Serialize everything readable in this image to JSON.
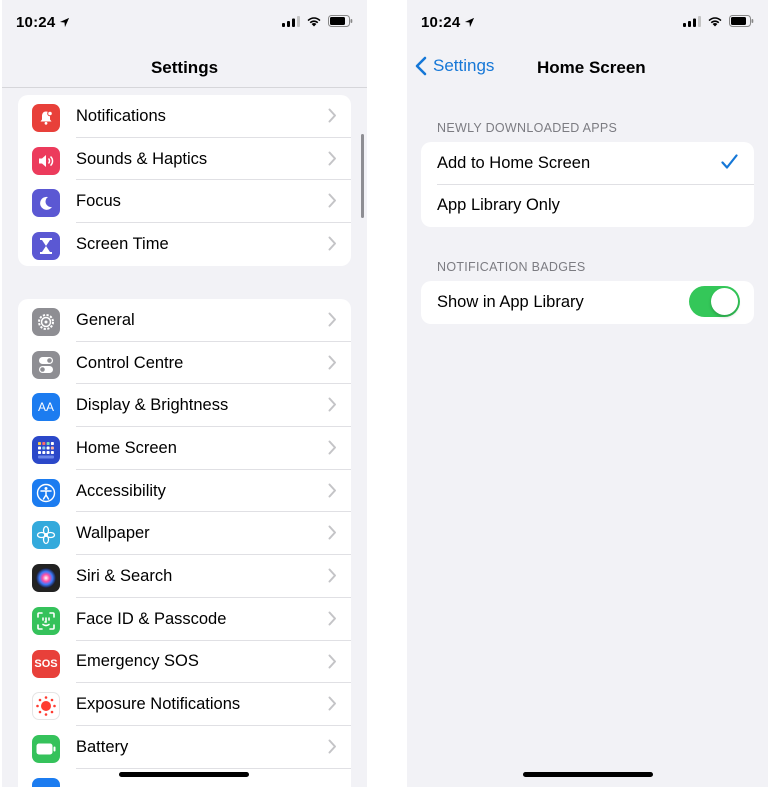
{
  "left": {
    "time": "10:24",
    "nav_title": "Settings",
    "group1": [
      {
        "label": "Notifications",
        "icon": "bell-icon",
        "color": "#e8403a"
      },
      {
        "label": "Sounds & Haptics",
        "icon": "speaker-icon",
        "color": "#ec3b5c"
      },
      {
        "label": "Focus",
        "icon": "moon-icon",
        "color": "#5b58d3"
      },
      {
        "label": "Screen Time",
        "icon": "hourglass-icon",
        "color": "#5b58d3"
      }
    ],
    "group2": [
      {
        "label": "General",
        "icon": "gear-icon",
        "color": "#8e8e93"
      },
      {
        "label": "Control Centre",
        "icon": "toggles-icon",
        "color": "#8e8e93"
      },
      {
        "label": "Display & Brightness",
        "icon": "text-size-icon",
        "icon_text": "AA",
        "color": "#1c7cf0"
      },
      {
        "label": "Home Screen",
        "icon": "home-grid-icon",
        "color": "#2b48c9"
      },
      {
        "label": "Accessibility",
        "icon": "accessibility-icon",
        "color": "#1c7cf0"
      },
      {
        "label": "Wallpaper",
        "icon": "flower-icon",
        "color": "#34aadc"
      },
      {
        "label": "Siri & Search",
        "icon": "siri-icon",
        "color": "#222222"
      },
      {
        "label": "Face ID & Passcode",
        "icon": "face-id-icon",
        "color": "#35c25b"
      },
      {
        "label": "Emergency SOS",
        "icon": "sos-icon",
        "icon_text": "SOS",
        "color": "#e8403a"
      },
      {
        "label": "Exposure Notifications",
        "icon": "exposure-icon",
        "color": "#ffffff"
      },
      {
        "label": "Battery",
        "icon": "battery-icon",
        "color": "#35c25b"
      }
    ]
  },
  "right": {
    "time": "10:24",
    "back_label": "Settings",
    "nav_title": "Home Screen",
    "section1_header": "NEWLY DOWNLOADED APPS",
    "section1_items": [
      "Add to Home Screen",
      "App Library Only"
    ],
    "section2_header": "NOTIFICATION BADGES",
    "section2_item": "Show in App Library",
    "toggle_on": true,
    "accent": "#1577d7",
    "toggle_color": "#34c759"
  }
}
